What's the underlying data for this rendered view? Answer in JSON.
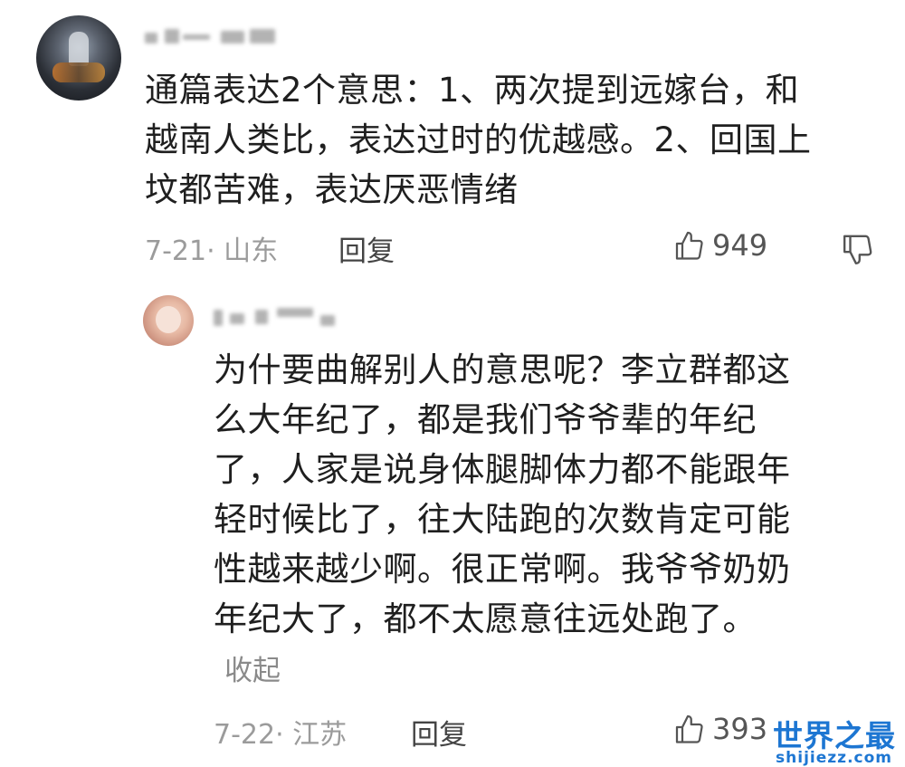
{
  "comment": {
    "text_lines": [
      "通篇表达2个意思：1、两次提到远嫁台，和",
      "越南人类比，表达过时的优越感。2、回国上",
      "坟都苦难，表达厌恶情绪"
    ],
    "meta": "7-21· 山东",
    "reply_label": "回复",
    "likes": "949"
  },
  "reply": {
    "text_lines": [
      "为什要曲解别人的意思呢？李立群都这",
      "么大年纪了，都是我们爷爷辈的年纪",
      "了，人家是说身体腿脚体力都不能跟年",
      "轻时候比了，往大陆跑的次数肯定可能",
      "性越来越少啊。很正常啊。我爷爷奶奶",
      "年纪大了，都不太愿意往远处跑了。"
    ],
    "collapse_label": "收起",
    "meta": "7-22· 江苏",
    "reply_label": "回复",
    "likes": "393"
  },
  "watermark": {
    "cn": "世界之最",
    "en": "shijiezz.com"
  },
  "icons": [
    "thumbs-up-icon",
    "thumbs-down-icon"
  ],
  "colors": {
    "watermark": "#1d76d2",
    "meta": "#9b9b9b"
  }
}
